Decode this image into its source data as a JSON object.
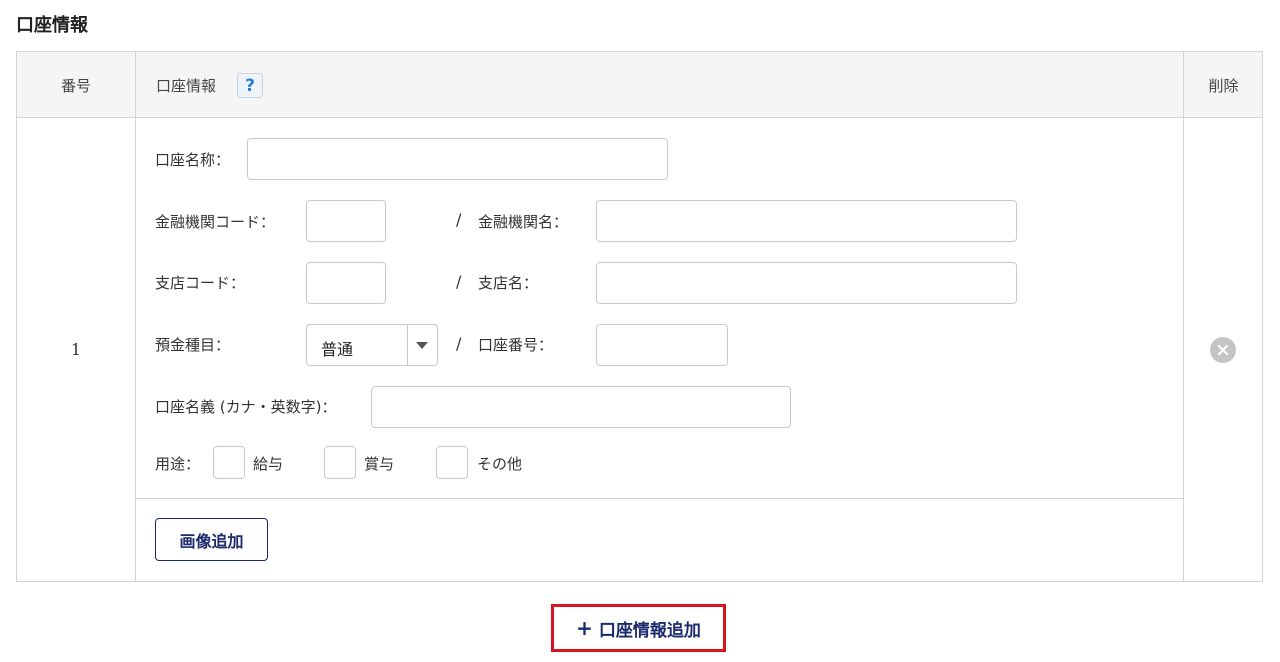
{
  "section_title": "口座情報",
  "table": {
    "headers": {
      "number": "番号",
      "info": "口座情報",
      "delete": "削除"
    },
    "help_icon": "?",
    "rows": [
      {
        "number": "1",
        "fields": {
          "account_name_label": "口座名称：",
          "bank_code_label": "金融機関コード：",
          "bank_name_label": "金融機関名：",
          "branch_code_label": "支店コード：",
          "branch_name_label": "支店名：",
          "deposit_type_label": "預金種目：",
          "deposit_type_value": "普通",
          "account_number_label": "口座番号：",
          "account_holder_label": "口座名義 (カナ・英数字)：",
          "usage_label": "用途：",
          "usage_options": [
            "給与",
            "賞与",
            "その他"
          ],
          "slash": "/"
        },
        "image_add_button": "画像追加"
      }
    ]
  },
  "add_account_button": {
    "icon": "+",
    "label": "口座情報追加"
  },
  "colors": {
    "accent": "#1c2a6b",
    "highlight_border": "#d9141f",
    "help": "#2a7dd3"
  }
}
